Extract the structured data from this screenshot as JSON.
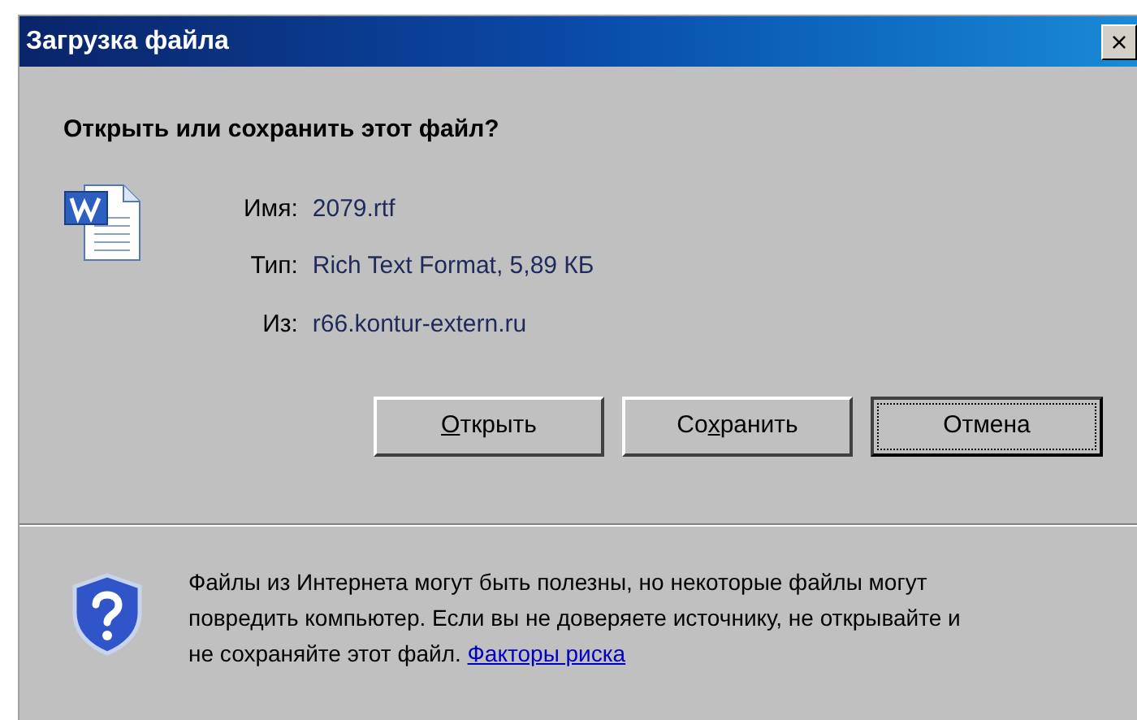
{
  "window": {
    "title": "Загрузка файла",
    "close": "×"
  },
  "question": "Открыть или сохранить этот файл?",
  "fields": [
    {
      "label": "Имя:",
      "value": "2079.rtf"
    },
    {
      "label": "Тип:",
      "value": "Rich Text Format, 5,89 КБ"
    },
    {
      "label": "Из:",
      "value": "r66.kontur-extern.ru"
    }
  ],
  "buttons": [
    {
      "access_key": "О",
      "after": "ткрыть",
      "default": false
    },
    {
      "before": "Со",
      "access_key": "х",
      "after": "ранить",
      "default": false
    },
    {
      "before": "Отмена",
      "default": true
    }
  ],
  "warning": {
    "text": "Файлы из Интернета могут быть полезны, но некоторые файлы могут повредить компьютер. Если вы не доверяете источнику, не открывайте и не сохраняйте этот файл.",
    "link": "Факторы риска"
  }
}
